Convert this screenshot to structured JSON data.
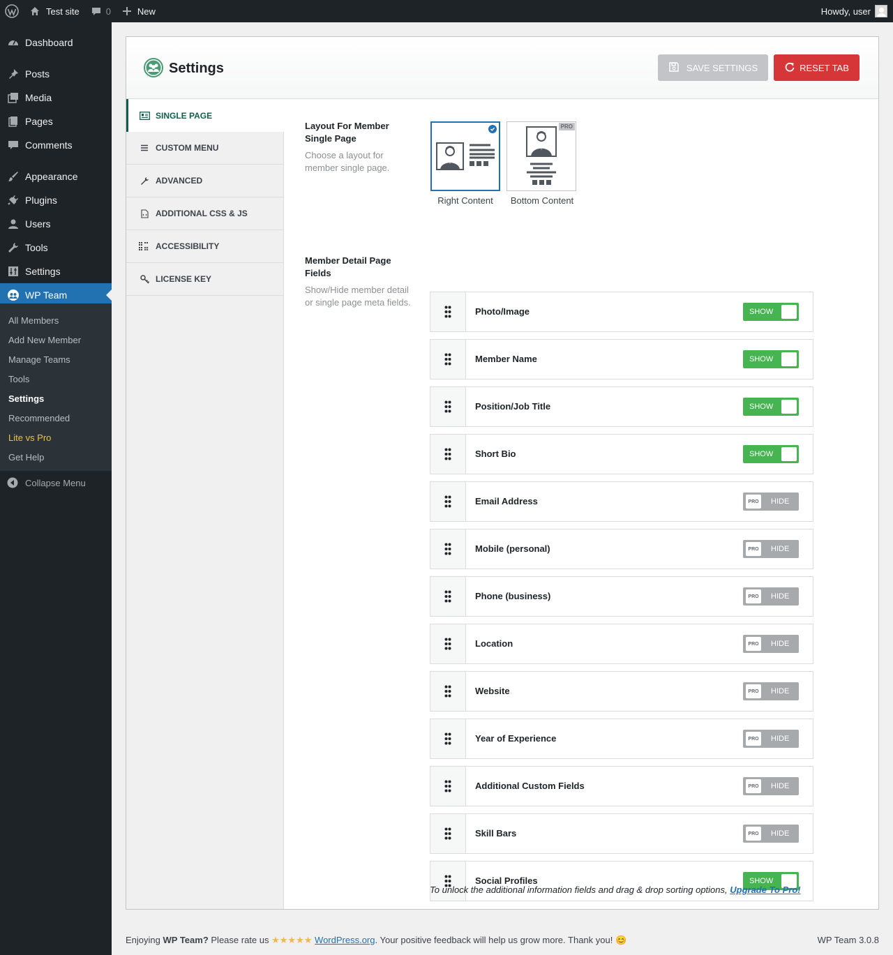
{
  "admin_bar": {
    "site_name": "Test site",
    "comments_count": "0",
    "new_label": "New",
    "greeting": "Howdy, user"
  },
  "sidebar": {
    "items": [
      {
        "label": "Dashboard",
        "icon": "dashboard-icon"
      },
      {
        "label": "Posts",
        "icon": "pin-icon"
      },
      {
        "label": "Media",
        "icon": "media-icon"
      },
      {
        "label": "Pages",
        "icon": "pages-icon"
      },
      {
        "label": "Comments",
        "icon": "comment-icon"
      },
      {
        "label": "Appearance",
        "icon": "brush-icon"
      },
      {
        "label": "Plugins",
        "icon": "plug-icon"
      },
      {
        "label": "Users",
        "icon": "user-icon"
      },
      {
        "label": "Tools",
        "icon": "wrench-icon"
      },
      {
        "label": "Settings",
        "icon": "sliders-icon"
      },
      {
        "label": "WP Team",
        "icon": "team-icon"
      }
    ],
    "submenu": [
      "All Members",
      "Add New Member",
      "Manage Teams",
      "Tools",
      "Settings",
      "Recommended",
      "Lite vs Pro",
      "Get Help"
    ],
    "collapse_label": "Collapse Menu"
  },
  "header": {
    "title": "Settings",
    "save_label": "SAVE SETTINGS",
    "reset_label": "RESET TAB"
  },
  "tabs": [
    "SINGLE PAGE",
    "CUSTOM MENU",
    "ADVANCED",
    "ADDITIONAL CSS & JS",
    "ACCESSIBILITY",
    "LICENSE KEY"
  ],
  "layout_section": {
    "label": "Layout For Member Single Page",
    "description": "Choose a layout for member single page.",
    "options": [
      {
        "caption": "Right Content",
        "selected": true
      },
      {
        "caption": "Bottom Content",
        "selected": false,
        "badge": "PRO"
      }
    ]
  },
  "fields_section": {
    "label": "Member Detail Page Fields",
    "description": "Show/Hide member detail or single page meta fields.",
    "fields": [
      {
        "name": "Photo/Image",
        "state": "SHOW"
      },
      {
        "name": "Member Name",
        "state": "SHOW"
      },
      {
        "name": "Position/Job Title",
        "state": "SHOW"
      },
      {
        "name": "Short Bio",
        "state": "SHOW"
      },
      {
        "name": "Email Address",
        "state": "HIDE",
        "pro": "PRO"
      },
      {
        "name": "Mobile (personal)",
        "state": "HIDE",
        "pro": "PRO"
      },
      {
        "name": "Phone (business)",
        "state": "HIDE",
        "pro": "PRO"
      },
      {
        "name": "Location",
        "state": "HIDE",
        "pro": "PRO"
      },
      {
        "name": "Website",
        "state": "HIDE",
        "pro": "PRO"
      },
      {
        "name": "Year of Experience",
        "state": "HIDE",
        "pro": "PRO"
      },
      {
        "name": "Additional Custom Fields",
        "state": "HIDE",
        "pro": "PRO"
      },
      {
        "name": "Skill Bars",
        "state": "HIDE",
        "pro": "PRO"
      },
      {
        "name": "Social Profiles",
        "state": "SHOW"
      }
    ],
    "upgrade_text": "To unlock the additional information fields and drag & drop sorting options,",
    "upgrade_link": "Upgrade To Pro!"
  },
  "footer": {
    "enjoying": "Enjoying",
    "plugin": "WP Team?",
    "rate": "Please rate us",
    "stars": "★★★★★",
    "link": "WordPress.org",
    "thanks": ". Your positive feedback will help us grow more. Thank you! 😊",
    "version": "WP Team 3.0.8"
  },
  "colors": {
    "accent": "#2271b1",
    "show": "#46b450",
    "reset": "#d63638",
    "brand_green": "#135e4b"
  }
}
